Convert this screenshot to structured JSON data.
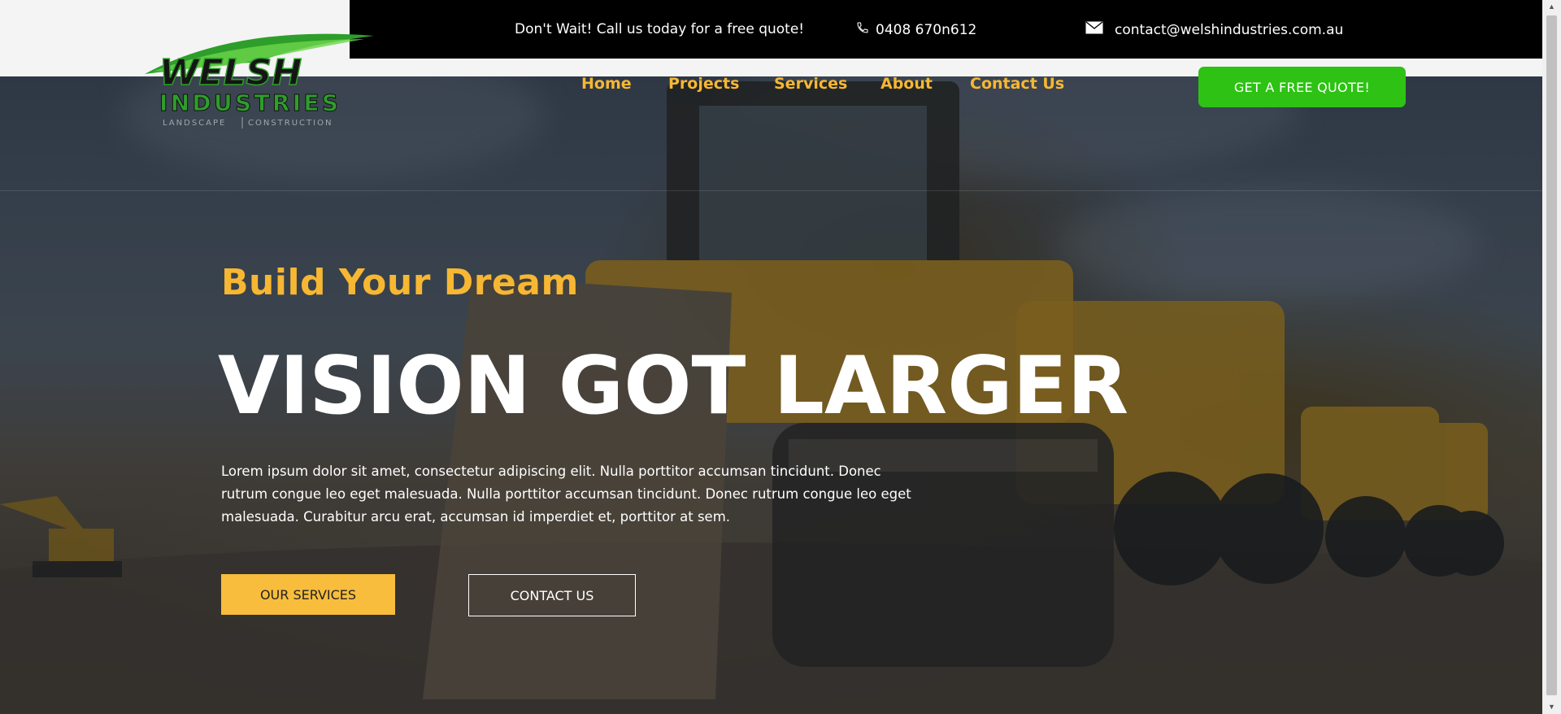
{
  "topbar": {
    "promo": "Don't Wait! Call us today for a free quote!",
    "phone": "0408 670n612",
    "email": "contact@welshindustries.com.au",
    "phone_icon": "phone-icon",
    "email_icon": "envelope-icon"
  },
  "logo": {
    "word1": "WELSH",
    "word2": "INDUSTRIES",
    "sub_left": "LANDSCAPE",
    "sub_right": "CONSTRUCTION"
  },
  "nav": {
    "items": [
      "Home",
      "Projects",
      "Services",
      "About",
      "Contact Us"
    ]
  },
  "cta": {
    "quote_label": "GET A FREE QUOTE!"
  },
  "hero": {
    "tagline": "Build Your Dream",
    "headline": "VISION GOT LARGER",
    "body": "Lorem ipsum dolor sit amet, consectetur adipiscing elit. Nulla porttitor accumsan tincidunt. Donec rutrum congue leo eget malesuada. Nulla porttitor accumsan tincidunt. Donec rutrum congue leo eget malesuada. Curabitur arcu erat, accumsan id imperdiet et, porttitor at sem.",
    "btn_services": "OUR SERVICES",
    "btn_contact": "CONTACT US"
  },
  "colors": {
    "accent": "#f7b733",
    "quote_green": "#2ec214",
    "topbar": "#000000",
    "logo_green": "#2e9e2a"
  }
}
